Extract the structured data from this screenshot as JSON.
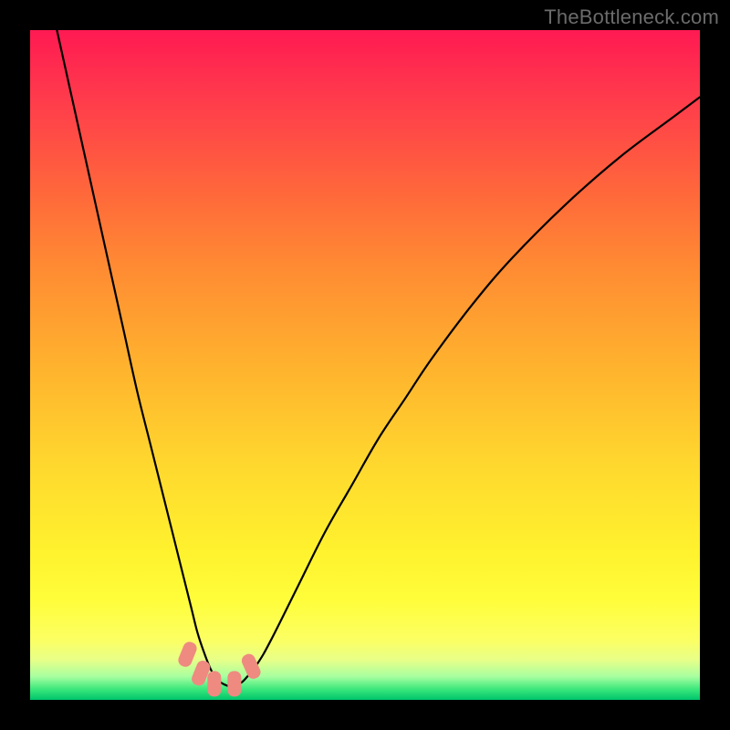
{
  "watermark": "TheBottleneck.com",
  "chart_data": {
    "type": "line",
    "title": "",
    "xlabel": "",
    "ylabel": "",
    "xlim": [
      0,
      100
    ],
    "ylim": [
      0,
      100
    ],
    "series": [
      {
        "name": "bottleneck-curve",
        "x": [
          4,
          6,
          8,
          10,
          12,
          14,
          16,
          18,
          20,
          22,
          24,
          25,
          26,
          27,
          28,
          29,
          30,
          31,
          32,
          34,
          36,
          40,
          44,
          48,
          52,
          56,
          60,
          66,
          72,
          80,
          88,
          96,
          100
        ],
        "y": [
          100,
          91,
          82,
          73,
          64,
          55,
          46,
          38,
          30,
          22,
          14,
          10,
          7,
          4.5,
          3,
          2.3,
          2,
          2.3,
          3,
          5.5,
          9,
          17,
          25,
          32,
          39,
          45,
          51,
          59,
          66,
          74,
          81,
          87,
          90
        ]
      }
    ],
    "markers": [
      {
        "name": "marker-left-upper",
        "x": 23.5,
        "y": 6.8
      },
      {
        "name": "marker-left-mid",
        "x": 25.5,
        "y": 4.0
      },
      {
        "name": "marker-bottom-left",
        "x": 27.5,
        "y": 2.4
      },
      {
        "name": "marker-bottom-right",
        "x": 30.5,
        "y": 2.4
      },
      {
        "name": "marker-right",
        "x": 33.0,
        "y": 5.0
      }
    ],
    "gradient_stops": [
      {
        "offset": 0.0,
        "color": "#ff1a52"
      },
      {
        "offset": 0.5,
        "color": "#ffb22e"
      },
      {
        "offset": 0.85,
        "color": "#fffd3a"
      },
      {
        "offset": 1.0,
        "color": "#00c46c"
      }
    ]
  }
}
